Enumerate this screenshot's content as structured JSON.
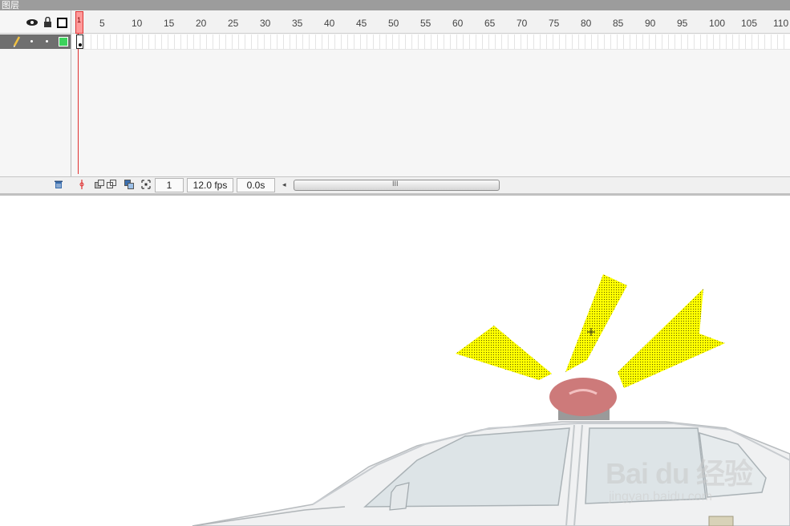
{
  "titlebar": {
    "title": "图层"
  },
  "ruler": {
    "labels": [
      "5",
      "10",
      "15",
      "20",
      "25",
      "30",
      "35",
      "40",
      "45",
      "50",
      "55",
      "60",
      "65",
      "70",
      "75",
      "80",
      "85",
      "90",
      "95",
      "100",
      "105",
      "110"
    ],
    "playhead_frame": "1"
  },
  "statusbar": {
    "current_frame": "1",
    "frame_rate": "12.0 fps",
    "elapsed_time": "0.0s",
    "scroll_grip": "III"
  },
  "watermark": {
    "brand": "Bai du 经验",
    "url": "jingyan.baidu.com"
  },
  "colors": {
    "flash_yellow": "#ffff00",
    "siren_red": "#cd7a7a",
    "layer_outline_green": "#3cd35c",
    "playhead_red": "#e03030"
  },
  "icons": [
    "eye-icon",
    "lock-icon",
    "outline-icon",
    "pencil-icon",
    "trash-icon",
    "onion-skin-icon",
    "edit-multiple-frames-icon",
    "modify-markers-icon",
    "center-frame-icon"
  ]
}
